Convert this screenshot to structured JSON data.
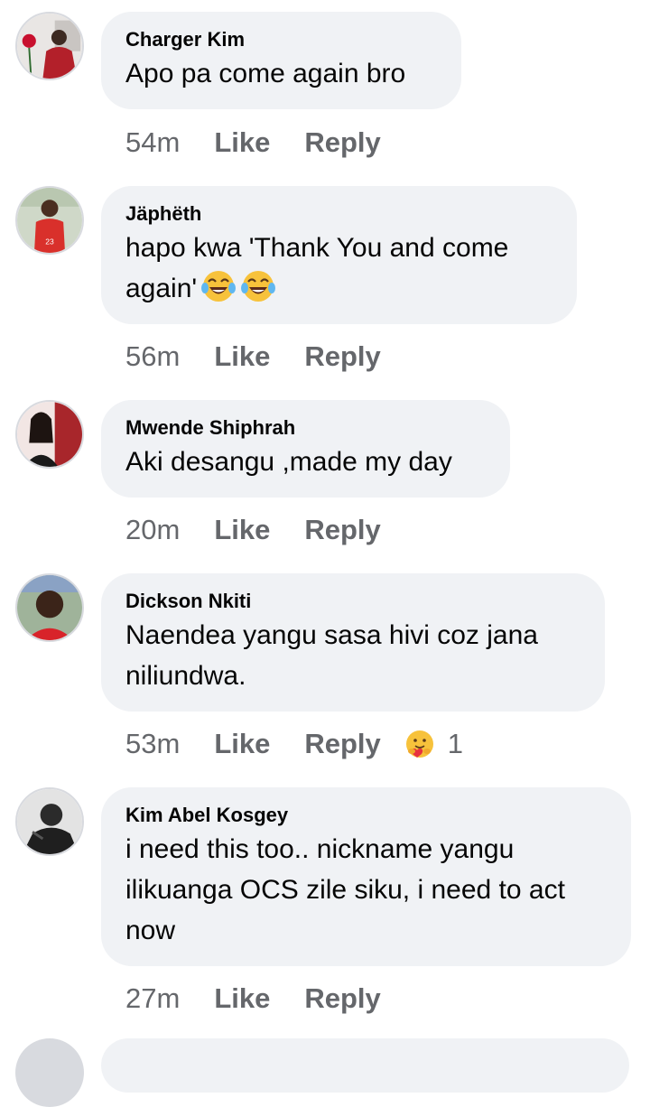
{
  "comments": [
    {
      "author": "Charger Kim",
      "text": "Apo pa come again bro",
      "time": "54m",
      "like": "Like",
      "reply": "Reply"
    },
    {
      "author": "Jäphëth",
      "text_line1": "hapo kwa 'Thank You and come",
      "text_line2": "again'",
      "emoji": [
        "face-with-tears-of-joy",
        "face-with-tears-of-joy"
      ],
      "time": "56m",
      "like": "Like",
      "reply": "Reply"
    },
    {
      "author": "Mwende Shiphrah",
      "text": "Aki desangu ,made my day",
      "time": "20m",
      "like": "Like",
      "reply": "Reply"
    },
    {
      "author": "Dickson Nkiti",
      "text_line1": "Naendea yangu sasa hivi coz jana",
      "text_line2": "niliundwa.",
      "time": "53m",
      "like": "Like",
      "reply": "Reply",
      "reaction": {
        "icon": "care-reaction-icon",
        "count": "1"
      }
    },
    {
      "author": "Kim Abel Kosgey",
      "text_line1": "i need this too.. nickname yangu",
      "text_line2": "ilikuanga OCS zile siku, i need to act",
      "text_line3": "now",
      "time": "27m",
      "like": "Like",
      "reply": "Reply"
    }
  ],
  "colors": {
    "bubble": "#f0f2f5",
    "meta_text": "#65676b",
    "text": "#050505"
  }
}
